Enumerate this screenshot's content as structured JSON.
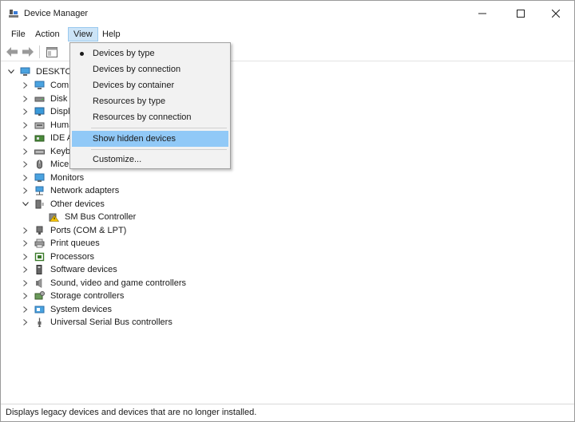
{
  "window": {
    "title": "Device Manager"
  },
  "menubar": {
    "items": [
      "File",
      "Action",
      "View",
      "Help"
    ]
  },
  "tree": {
    "root": "DESKTOP",
    "rows": [
      {
        "label": "Computer",
        "icon": "computer-icon"
      },
      {
        "label": "Disk drives",
        "icon": "disk-icon"
      },
      {
        "label": "Display adapters",
        "icon": "display-icon"
      },
      {
        "label": "Human Interface Devices",
        "icon": "hid-icon"
      },
      {
        "label": "IDE ATA/ATAPI controllers",
        "icon": "ide-icon"
      },
      {
        "label": "Keyboards",
        "icon": "keyboard-icon"
      },
      {
        "label": "Mice and other pointing devices",
        "icon": "mouse-icon"
      },
      {
        "label": "Monitors",
        "icon": "monitor-icon"
      },
      {
        "label": "Network adapters",
        "icon": "network-icon"
      },
      {
        "label": "Other devices",
        "icon": "other-devices-icon",
        "expanded": true
      },
      {
        "label": "SM Bus Controller",
        "icon": "warning-device-icon",
        "child": true
      },
      {
        "label": "Ports (COM & LPT)",
        "icon": "port-icon"
      },
      {
        "label": "Print queues",
        "icon": "printer-icon"
      },
      {
        "label": "Processors",
        "icon": "processor-icon"
      },
      {
        "label": "Software devices",
        "icon": "software-icon"
      },
      {
        "label": "Sound, video and game controllers",
        "icon": "sound-icon"
      },
      {
        "label": "Storage controllers",
        "icon": "storage-icon"
      },
      {
        "label": "System devices",
        "icon": "system-icon"
      },
      {
        "label": "Universal Serial Bus controllers",
        "icon": "usb-icon"
      }
    ]
  },
  "view_menu": {
    "items": [
      {
        "label": "Devices by type",
        "checked": true
      },
      {
        "label": "Devices by connection"
      },
      {
        "label": "Devices by container"
      },
      {
        "label": "Resources by type"
      },
      {
        "label": "Resources by connection"
      },
      {
        "label": "Show hidden devices",
        "highlighted": true
      },
      {
        "label": "Customize..."
      }
    ]
  },
  "statusbar": {
    "text": "Displays legacy devices and devices that are no longer installed."
  },
  "colors": {
    "highlight": "#91c9f7",
    "menu_active": "#cce4f7",
    "menu_bg": "#f2f2f2"
  }
}
